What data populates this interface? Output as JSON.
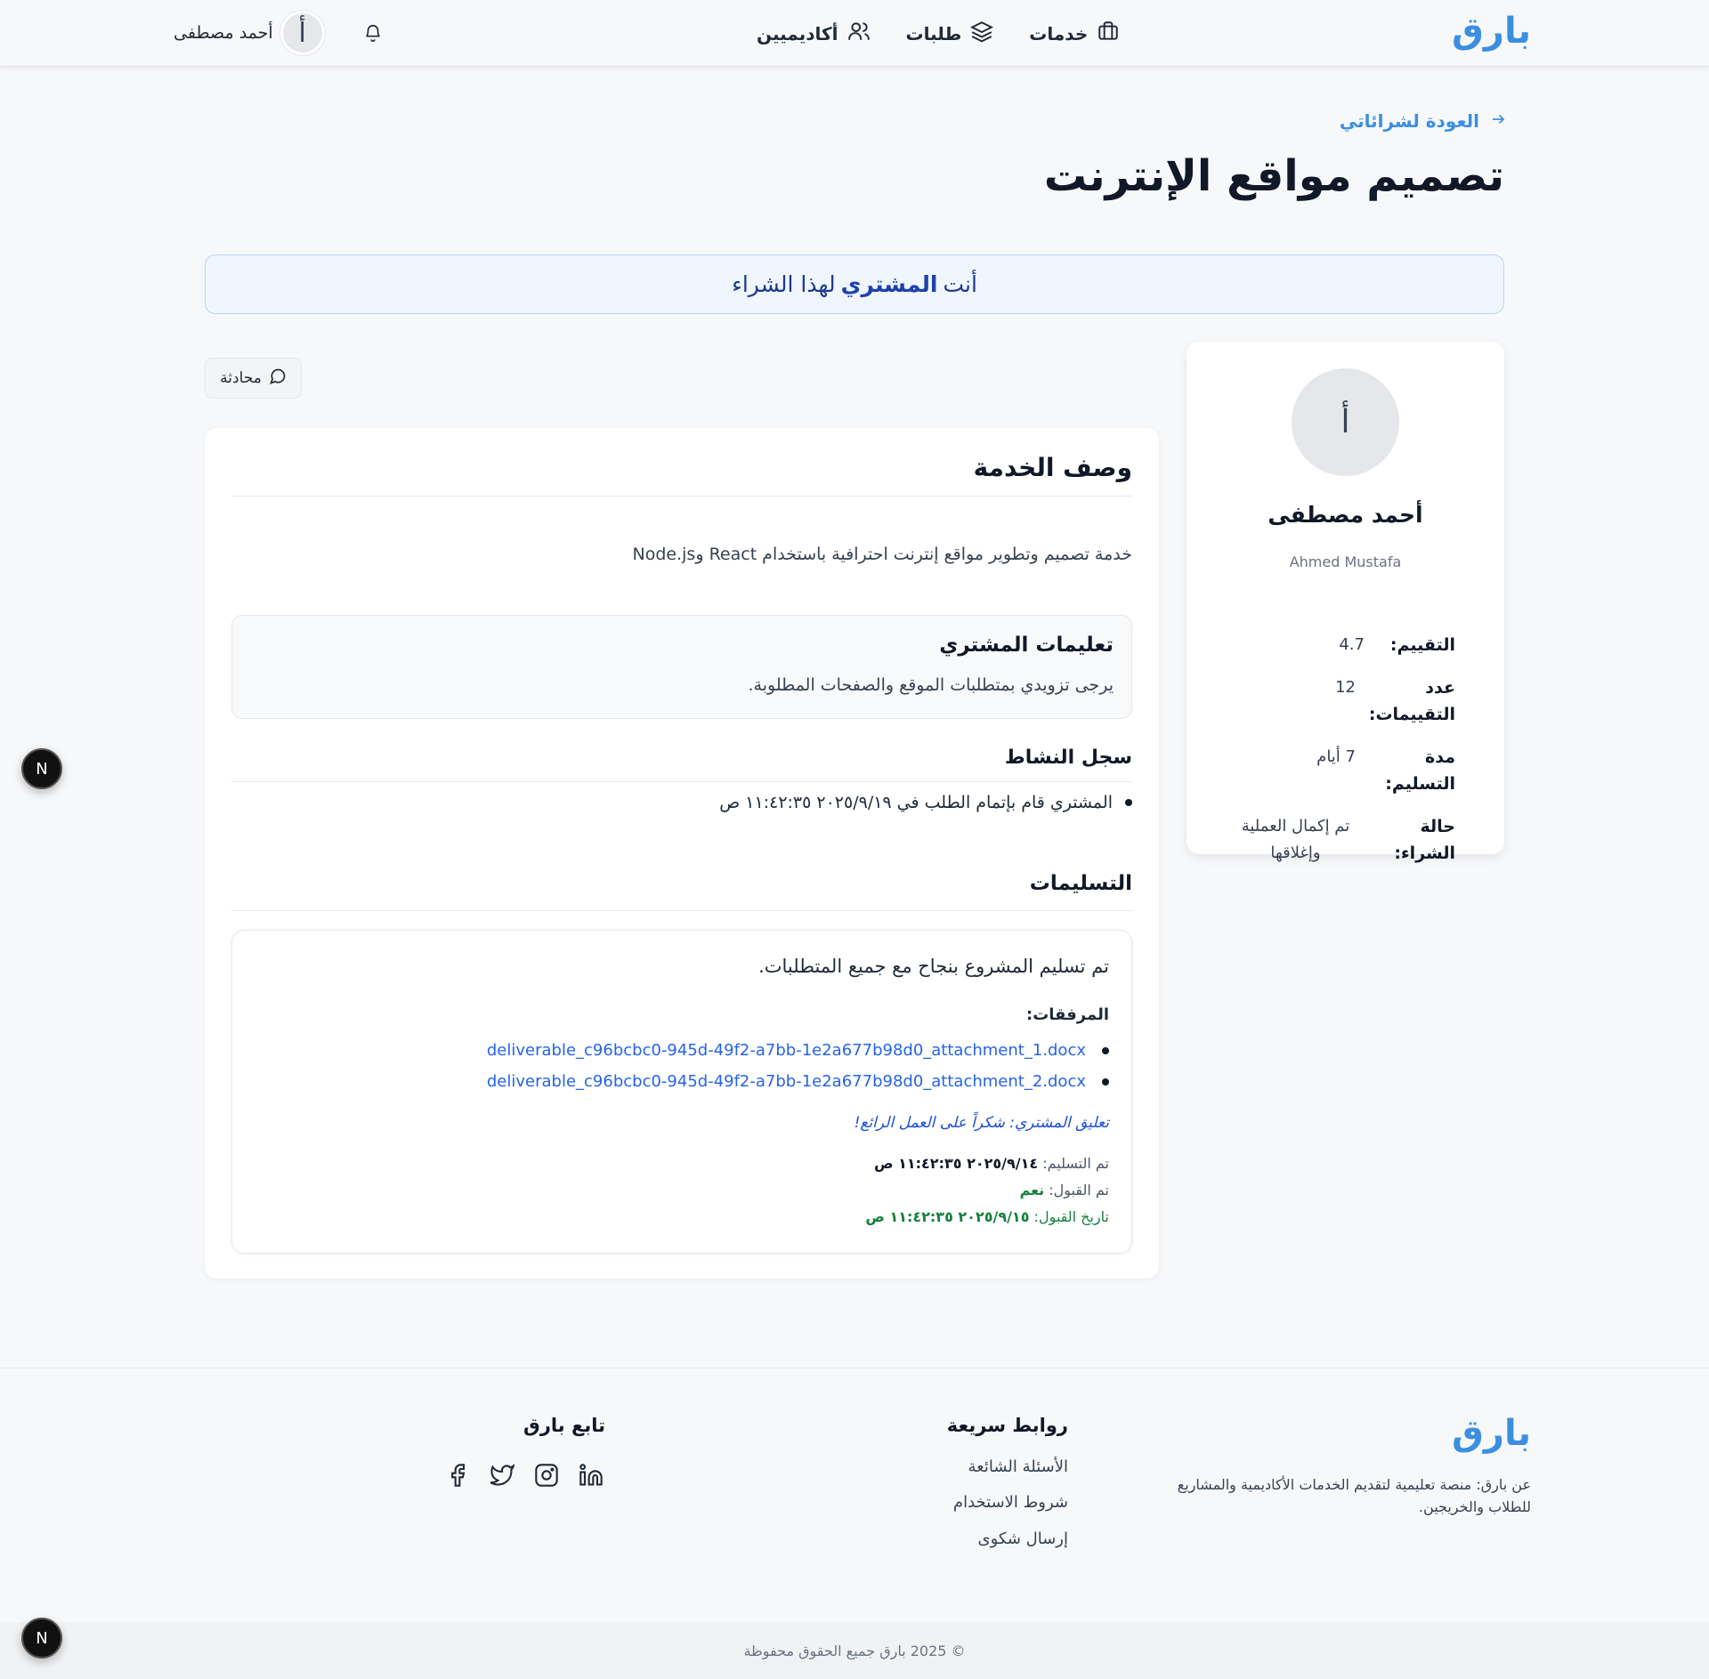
{
  "header": {
    "logo": "بارق",
    "nav": [
      {
        "label": "خدمات",
        "icon": "briefcase-icon"
      },
      {
        "label": "طلبات",
        "icon": "layers-icon"
      },
      {
        "label": "أكاديميين",
        "icon": "users-icon"
      }
    ],
    "user_name": "أحمد مصطفى",
    "user_initial": "أ"
  },
  "back_link": "العودة لشرائاتي",
  "page_title": "تصميم مواقع الإنترنت",
  "banner": {
    "prefix": "أنت",
    "role": "المشتري",
    "suffix": "لهذا الشراء"
  },
  "seller": {
    "initial": "أ",
    "name_ar": "أحمد مصطفى",
    "name_en": "Ahmed Mustafa",
    "stats": [
      {
        "label": "التقييم:",
        "value": "4.7"
      },
      {
        "label": "عدد التقييمات:",
        "value": "12"
      },
      {
        "label": "مدة التسليم:",
        "value": "7 أيام"
      },
      {
        "label": "حالة الشراء:",
        "value": "تم إكمال العملية وإغلاقها"
      }
    ]
  },
  "chat_button": "محادثة",
  "service": {
    "title": "وصف الخدمة",
    "description": "خدمة تصميم وتطوير مواقع إنترنت احترافية باستخدام React وNode.js",
    "instructions_title": "تعليمات المشتري",
    "instructions_text": "يرجى تزويدي بمتطلبات الموقع والصفحات المطلوبة.",
    "activity_title": "سجل النشاط",
    "activity": [
      "المشتري قام بإتمام الطلب في ٢٠٢٥/٩/١٩ ١١:٤٢:٣٥ ص"
    ],
    "deliverables_title": "التسليمات",
    "delivery": {
      "message": "تم تسليم المشروع بنجاح مع جميع المتطلبات.",
      "attachments_title": "المرفقات:",
      "attachments": [
        "deliverable_c96bcbc0-945d-49f2-a7bb-1e2a677b98d0_attachment_1.docx",
        "deliverable_c96bcbc0-945d-49f2-a7bb-1e2a677b98d0_attachment_2.docx"
      ],
      "comment": "تعليق المشتري: شكراً على العمل الرائع!",
      "delivered_label": "تم التسليم:",
      "delivered_value": "٢٠٢٥/٩/١٤ ١١:٤٢:٣٥ ص",
      "accepted_label": "تم القبول:",
      "accepted_value": "نعم",
      "accept_date_label": "تاريخ القبول:",
      "accept_date_value": "٢٠٢٥/٩/١٥ ١١:٤٢:٣٥ ص"
    }
  },
  "footer": {
    "logo": "بارق",
    "about": "عن بارق: منصة تعليمية لتقديم الخدمات الأكاديمية والمشاريع للطلاب والخريجين.",
    "links_title": "روابط سريعة",
    "links": [
      "الأسئلة الشائعة",
      "شروط الاستخدام",
      "إرسال شكوى"
    ],
    "follow_title": "تابع بارق",
    "socials": [
      "facebook-icon",
      "twitter-icon",
      "instagram-icon",
      "linkedin-icon"
    ],
    "copyright": "© 2025 بارق جميع الحقوق محفوظة"
  },
  "badge": "N",
  "colors": {
    "brand": "#3b8fe0",
    "link": "#2563eb",
    "success": "#15803d"
  }
}
